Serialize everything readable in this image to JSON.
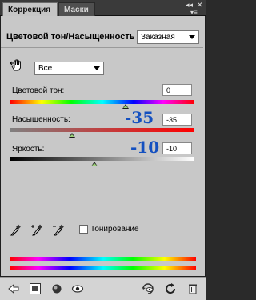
{
  "tabs": [
    {
      "label": "Коррекция"
    },
    {
      "label": "Маски"
    }
  ],
  "panel": {
    "title": "Цветовой тон/Насыщенность",
    "preset": "Заказная",
    "channel": "Все"
  },
  "sliders": {
    "hue": {
      "label": "Цветовой тон:",
      "value": "0",
      "position": 0.5
    },
    "saturation": {
      "label": "Насыщенность:",
      "value": "-35",
      "big": "-35",
      "position": 0.325
    },
    "lightness": {
      "label": "Яркость:",
      "value": "-10",
      "big": "-10",
      "position": 0.45
    }
  },
  "colorize": {
    "label": "Тонирование"
  },
  "colors": {
    "accent_number": "#1450c0",
    "thumb_fill": "#9cd07a"
  },
  "icons": {
    "hand_tool": "hand-icon",
    "eyedropper": "eyedropper-icon",
    "eyedropper_add": "eyedropper-plus-icon",
    "eyedropper_sub": "eyedropper-minus-icon",
    "back": "back-arrow-icon",
    "expand": "expand-icon",
    "layer": "circle-icon",
    "visibility": "eye-icon",
    "previous": "eye-arrow-icon",
    "reset": "reset-icon",
    "trash": "trash-icon"
  }
}
